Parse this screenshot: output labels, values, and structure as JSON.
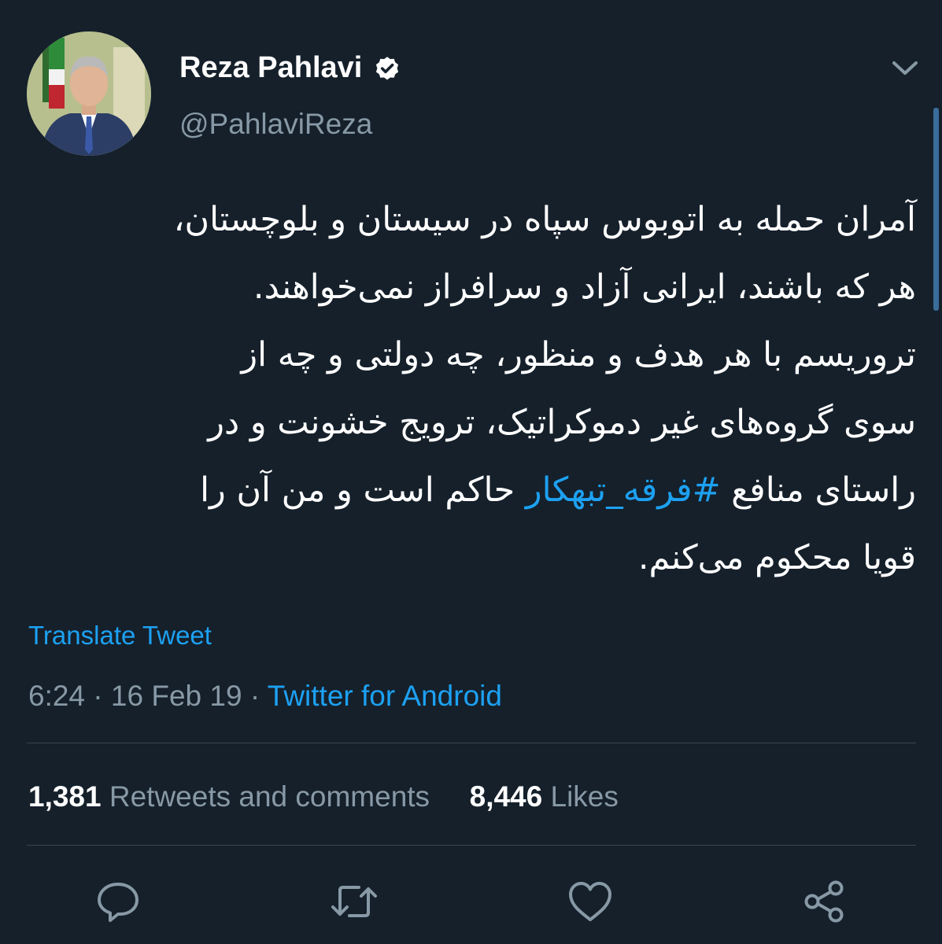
{
  "author": {
    "display_name": "Reza Pahlavi",
    "handle": "@PahlaviReza"
  },
  "tweet": {
    "lines_before_hashtag": [
      "آمران حمله به اتوبوس سپاه در سیستان و بلوچستان،",
      "هر که باشند، ایرانی آزاد و سرافراز نمی‌خواهند.",
      "تروریسم با هر هدف و منظور، چه دولتی و چه از",
      "سوی گروه‌های غیر دموکراتیک، ترویج خشونت و در"
    ],
    "line5_start": "راستای منافع ",
    "hashtag": "#فرقه_تبهکار",
    "line5_end": " حاکم است و من آن را",
    "last_line": "قویا محکوم می‌کنم."
  },
  "translate_label": "Translate Tweet",
  "meta": {
    "time": "6:24",
    "separator_1": " · ",
    "date": "16 Feb 19",
    "separator_2": " · ",
    "source": "Twitter for Android"
  },
  "stats": {
    "retweets_count": "1,381",
    "retweets_label": "Retweets and comments",
    "likes_count": "8,446",
    "likes_label": "Likes"
  },
  "actions": [
    "reply-icon",
    "retweet-icon",
    "like-icon",
    "share-icon"
  ],
  "colors": {
    "background": "#15202b",
    "text": "#ffffff",
    "secondary": "#8899a6",
    "accent": "#1da1f2",
    "divider": "#38444d"
  }
}
